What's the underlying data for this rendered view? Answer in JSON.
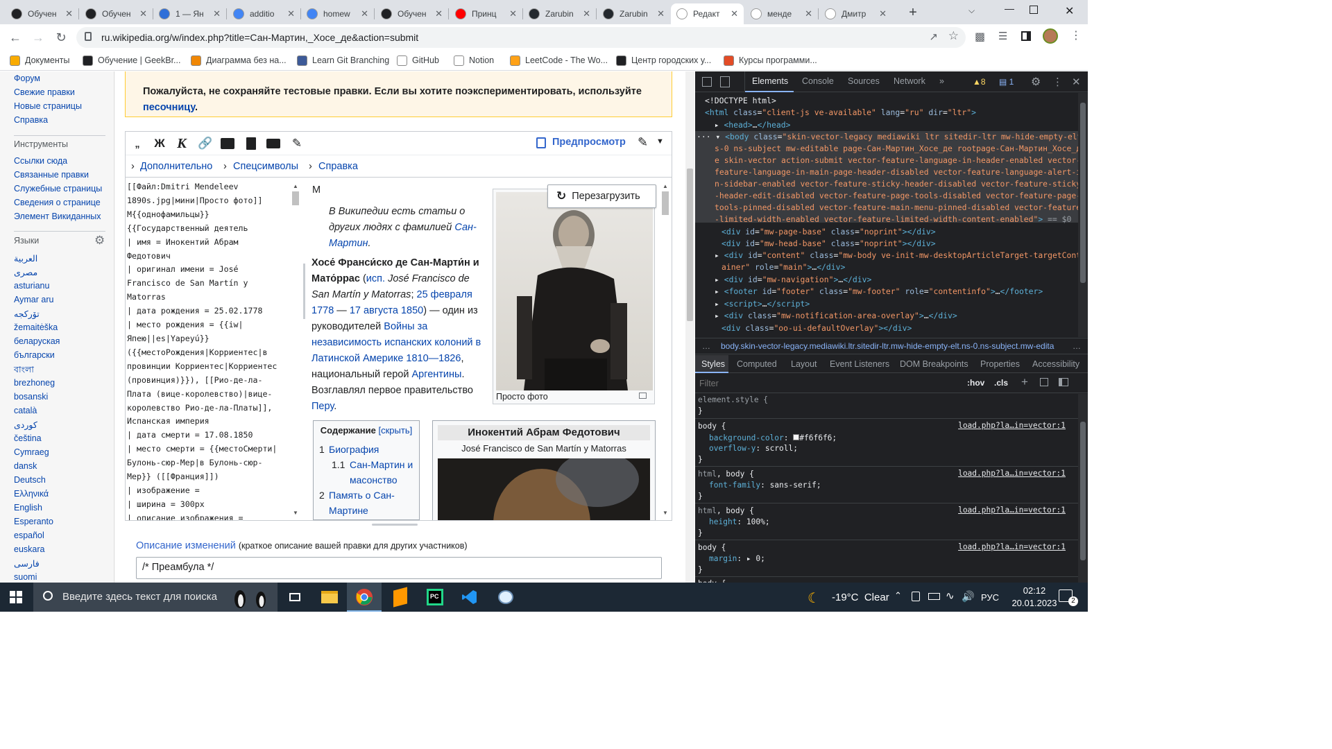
{
  "browser": {
    "tabs": [
      {
        "title": "Обучен",
        "fav": "#202124"
      },
      {
        "title": "Обучен",
        "fav": "#202124"
      },
      {
        "title": "1 — Ян",
        "fav": "#2f6fd8"
      },
      {
        "title": "additio",
        "fav": "#4285f4"
      },
      {
        "title": "homew",
        "fav": "#4285f4"
      },
      {
        "title": "Обучен",
        "fav": "#202124"
      },
      {
        "title": "Принц",
        "fav": "#ff0000"
      },
      {
        "title": "Zarubin",
        "fav": "#24292e"
      },
      {
        "title": "Zarubin",
        "fav": "#24292e"
      },
      {
        "title": "Редакт",
        "fav": "#ffffff"
      },
      {
        "title": "менде",
        "fav": "#ffffff"
      },
      {
        "title": "Дмитр",
        "fav": "#ffffff"
      }
    ],
    "new_tab": "+",
    "url": "ru.wikipedia.org/w/index.php?title=Сан-Мартин,_Хосе_де&action=submit",
    "bookmarks": [
      {
        "label": "Документы",
        "color": "#f9ab00"
      },
      {
        "label": "Обучение | GeekBr...",
        "color": "#202124"
      },
      {
        "label": "Диаграмма без на...",
        "color": "#f08705"
      },
      {
        "label": "Learn Git Branching",
        "color": "#3d5a98"
      },
      {
        "label": "GitHub",
        "color": "#ffffff"
      },
      {
        "label": "Notion",
        "color": "#ffffff"
      },
      {
        "label": "LeetCode - The Wo...",
        "color": "#ffa116"
      },
      {
        "label": "Центр городских у...",
        "color": "#202124"
      },
      {
        "label": "Курсы программи...",
        "color": "#e34c26"
      }
    ]
  },
  "wiki": {
    "nav_top": [
      "Форум",
      "Свежие правки",
      "Новые страницы",
      "Справка"
    ],
    "tools_heading": "Инструменты",
    "tools": [
      "Ссылки сюда",
      "Связанные правки",
      "Служебные страницы",
      "Сведения о странице",
      "Элемент Викиданных"
    ],
    "langs_heading": "Языки",
    "langs": [
      "العربية",
      "مصرى",
      "asturianu",
      "Aymar aru",
      "تۆرکجه",
      "žemaitėška",
      "беларуская",
      "български",
      "বাংলা",
      "brezhoneg",
      "bosanski",
      "català",
      "کوردی",
      "čeština",
      "Cymraeg",
      "dansk",
      "Deutsch",
      "Ελληνικά",
      "English",
      "Esperanto",
      "español",
      "euskara",
      "فارسی",
      "suomi"
    ],
    "notice_l1": "Пожалуйста, не сохраняйте тестовые правки. Если вы хотите поэкспериментировать, используйте",
    "notice_link": "песочницу",
    "notice_end": ".",
    "preview_btn": "Предпросмотр",
    "toolbar2": [
      "Дополнительно",
      "Спецсимволы",
      "Справка"
    ],
    "wikitext": [
      "[[Файл:Dmitri Mendeleev",
      "1890s.jpg|мини|Просто фото]]",
      "М{{однофамильцы}}",
      "{{Государственный деятель",
      "| имя = Инокентий Абрам",
      "Федотович",
      "| оригинал имени = José",
      "Francisco de San Martín y",
      "Matorras",
      "| дата рождения = 25.02.1778",
      "| место рождения = {{iw|",
      "Япею||es|Yapeyú}}",
      "({{местоРождения|Корриентес|в",
      "провинции Корриентес|Корриентес",
      "(провинция)}}), [[Рио-де-ла-",
      "Плата (вице-королевство)|вице-",
      "королевство Рио-де-ла-Платы]],",
      "Испанская империя",
      "| дата смерти = 17.08.1850",
      "| место смерти = {{местоСмерти|",
      "Булонь-сюр-Мер|в Булонь-сюр-",
      "Мер}} ([[Франция]])",
      "| изображение =",
      "| ширина = 300px",
      "| описание изображения ="
    ],
    "preview_letter": "М",
    "hatnote_prefix": "В Википедии есть статьи о других людях с фамилией ",
    "hatnote_link": "Сан-Мартин",
    "reload_btn": "Перезагрузить",
    "photo_caption": "Просто фото",
    "lead_bold": "Хосе́ Франси́ско де Сан-Марти́н и Мато́ррас",
    "lead_isp": "исп.",
    "lead_orig": "José Francisco de San Martín y Matorras",
    "lead_date1": "25 февраля 1778",
    "lead_date2": "17 августа 1850",
    "lead_mid": ") — один из руководителей ",
    "lead_link1": "Войны за независимость испанских колоний в Латинской Америке 1810—1826",
    "lead_mid2": ", национальный герой ",
    "lead_link2": "Аргентины",
    "lead_mid3": ". Возглавлял первое правительство ",
    "lead_link3": "Перу",
    "toc_title": "Содержание",
    "toc_hide": "[скрыть]",
    "toc": [
      {
        "num": "1",
        "text": "Биография"
      },
      {
        "num": "1.1",
        "text": "Сан-Мартин и масонство"
      },
      {
        "num": "2",
        "text": "Память о Сан-Мартине"
      }
    ],
    "infobox_title": "Инокентий Абрам Федотович",
    "infobox_sub": "José Francisco de San Martín y Matorras",
    "summary_label": "Описание изменений",
    "summary_hint": "(краткое описание вашей правки для других участников)",
    "summary_value": "/* Преамбула */"
  },
  "devtools": {
    "tabs": [
      "Elements",
      "Console",
      "Sources",
      "Network"
    ],
    "warn_count": "8",
    "info_count": "1",
    "breadcrumb": "body.skin-vector-legacy.mediawiki.ltr.sitedir-ltr.mw-hide-empty-elt.ns-0.ns-subject.mw-edita",
    "subtabs": [
      "Styles",
      "Computed",
      "Layout",
      "Event Listeners",
      "DOM Breakpoints",
      "Properties",
      "Accessibility"
    ],
    "filter_placeholder": "Filter",
    "hov": ":hov",
    "cls": ".cls",
    "rule_source": "load.php?la…in=vector:1",
    "bg_color_value": "#f6f6f6"
  },
  "taskbar": {
    "search_placeholder": "Введите здесь текст для поиска",
    "weather": "-19°C  Clear",
    "lang": "РУС",
    "time": "02:12",
    "date": "20.01.2023",
    "notif_count": "2"
  }
}
